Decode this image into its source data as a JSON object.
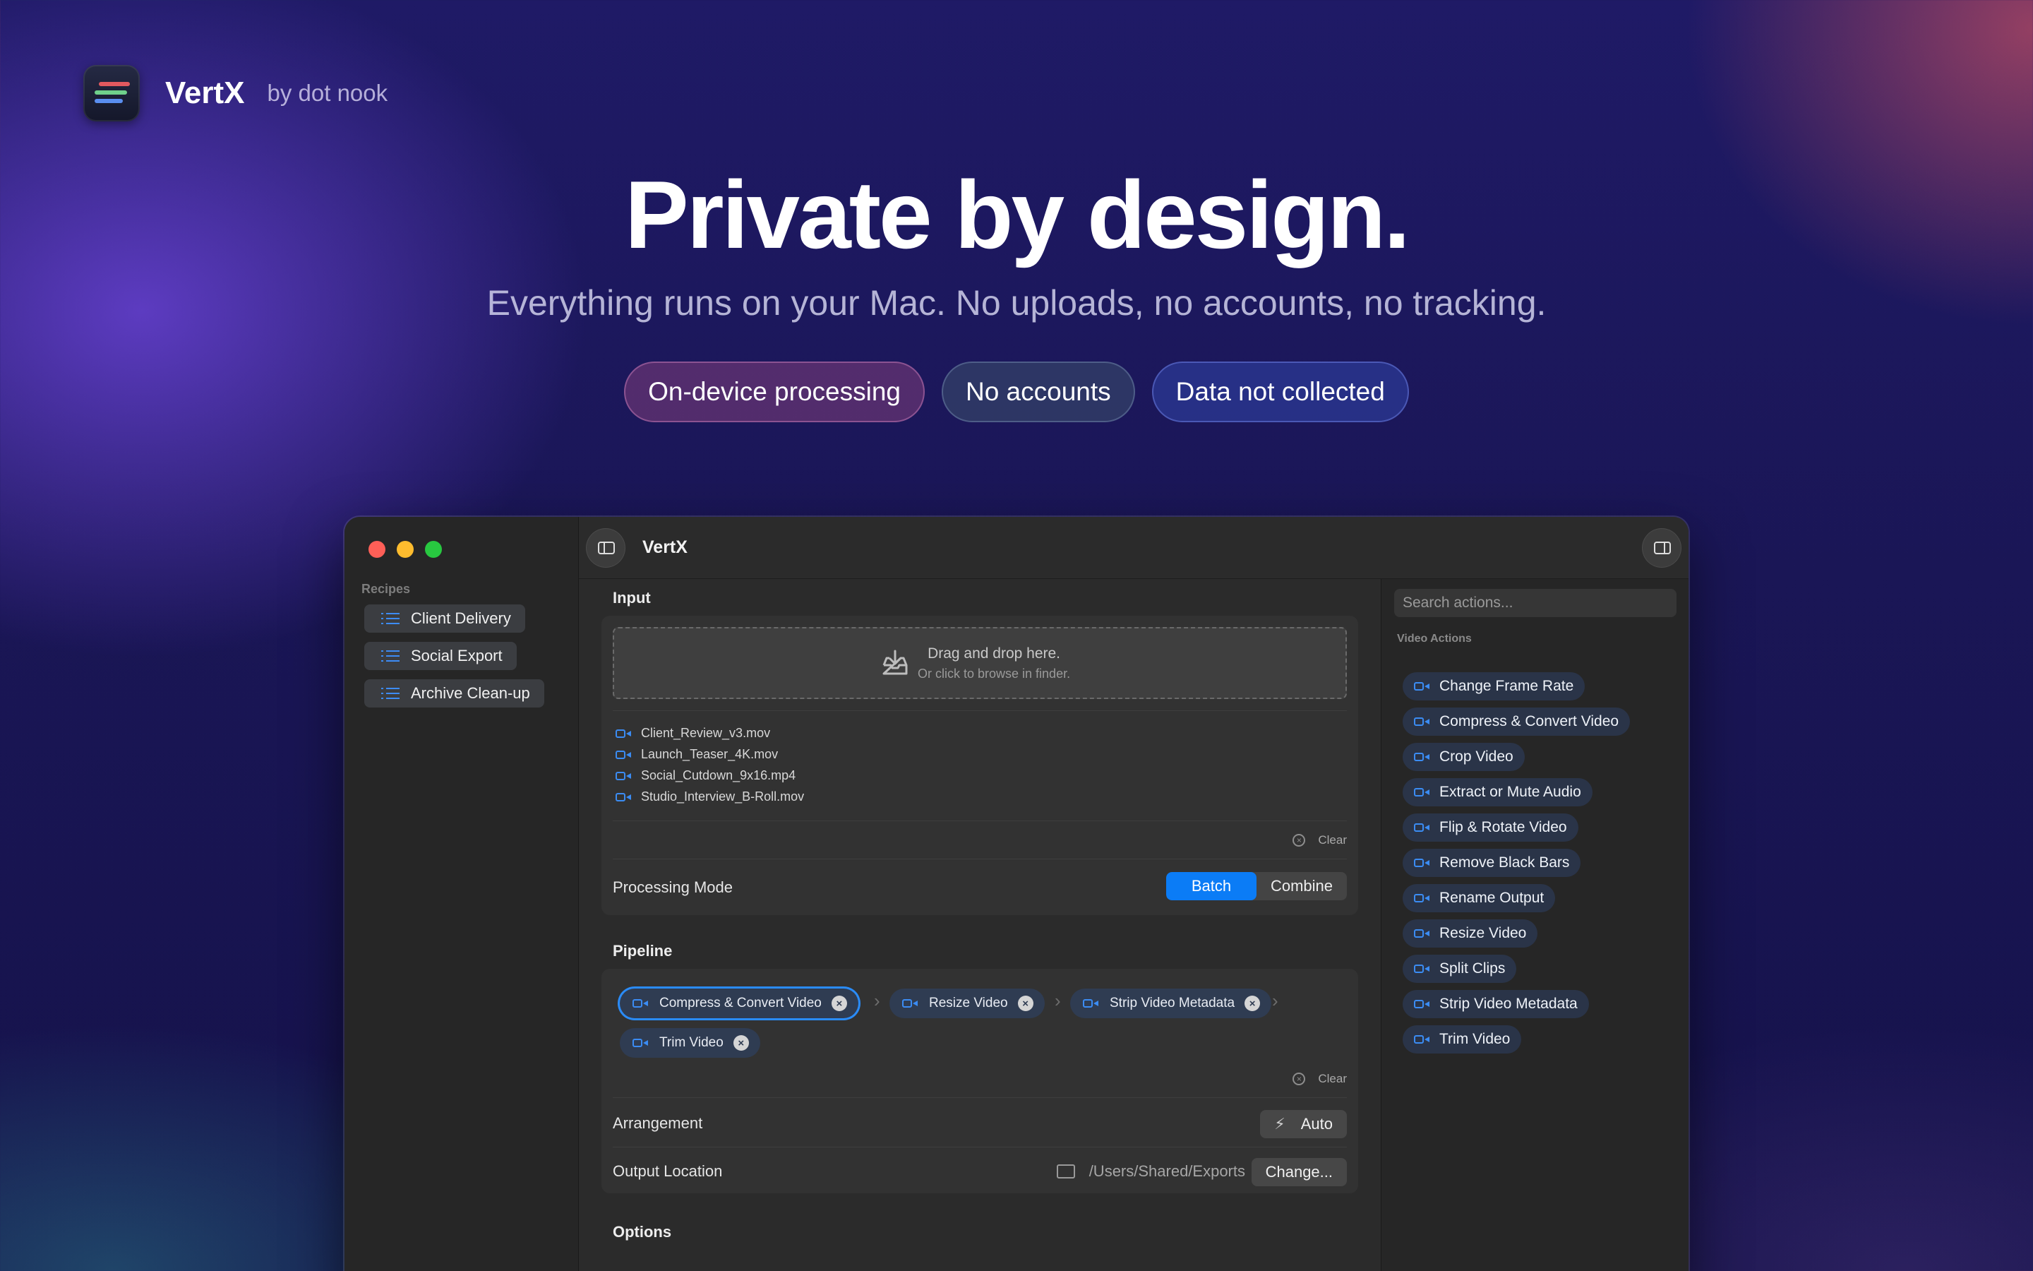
{
  "brand": {
    "name": "VertX",
    "by": "by dot nook"
  },
  "hero": {
    "title": "Private by design.",
    "subtitle": "Everything runs on your Mac. No uploads, no accounts, no tracking.",
    "pills": [
      "On-device processing",
      "No accounts",
      "Data not collected"
    ]
  },
  "window": {
    "title": "VertX",
    "sidebar": {
      "section_label": "Recipes",
      "recipes": [
        "Client Delivery",
        "Social Export",
        "Archive Clean-up"
      ]
    },
    "input": {
      "title": "Input",
      "drop_main": "Drag and drop here.",
      "drop_sub": "Or click to browse in finder.",
      "files": [
        "Client_Review_v3.mov",
        "Launch_Teaser_4K.mov",
        "Social_Cutdown_9x16.mp4",
        "Studio_Interview_B-Roll.mov"
      ],
      "clear_label": "Clear",
      "processing_mode_label": "Processing Mode",
      "modes": [
        "Batch",
        "Combine"
      ],
      "selected_mode": "Batch"
    },
    "pipeline": {
      "title": "Pipeline",
      "steps": [
        "Compress & Convert Video",
        "Resize Video",
        "Strip Video Metadata",
        "Trim Video"
      ],
      "clear_label": "Clear",
      "arrangement_label": "Arrangement",
      "arrangement_value": "Auto",
      "output_label": "Output Location",
      "output_path": "/Users/Shared/Exports",
      "change_label": "Change..."
    },
    "options": {
      "title": "Options"
    },
    "actions": {
      "search_placeholder": "Search actions...",
      "section_label": "Video Actions",
      "items": [
        "Change Frame Rate",
        "Compress & Convert Video",
        "Crop Video",
        "Extract or Mute Audio",
        "Flip & Rotate Video",
        "Remove Black Bars",
        "Rename Output",
        "Resize Video",
        "Split Clips",
        "Strip Video Metadata",
        "Trim Video"
      ]
    }
  },
  "colors": {
    "accent": "#0b7cf6",
    "icon_blue": "#3b8cf3"
  }
}
